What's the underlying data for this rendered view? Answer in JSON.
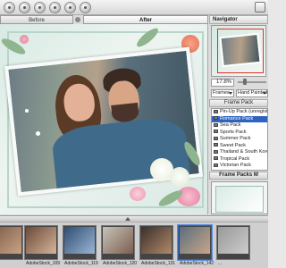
{
  "tabs": {
    "before": "Before",
    "after": "After"
  },
  "navigator": {
    "title": "Navigator",
    "zoom": "17.8%"
  },
  "frame_selector": {
    "type": "Frames",
    "style": "Hand Painted"
  },
  "frame_packs": {
    "title": "Frame Pack",
    "items": [
      {
        "label": "Pin-Up Pack (unregistered)",
        "selected": false
      },
      {
        "label": "Romance Pack",
        "selected": true
      },
      {
        "label": "Sea Pack",
        "selected": false
      },
      {
        "label": "Sports Pack",
        "selected": false
      },
      {
        "label": "Summer Pack",
        "selected": false
      },
      {
        "label": "Sweet Pack",
        "selected": false
      },
      {
        "label": "Thailand & South Korea",
        "selected": false
      },
      {
        "label": "Tropical Pack",
        "selected": false
      },
      {
        "label": "Victorian Pack",
        "selected": false
      }
    ]
  },
  "frame_pack_preview": {
    "title": "Frame Packs M"
  },
  "filmstrip": {
    "items": [
      {
        "label": "...",
        "colors": [
          "#7a5b48",
          "#c9a284"
        ]
      },
      {
        "label": "AdobeStock_109",
        "colors": [
          "#6a4a3a",
          "#d6b59a"
        ]
      },
      {
        "label": "AdobeStock_119",
        "colors": [
          "#2f4d72",
          "#9bb6d4"
        ]
      },
      {
        "label": "AdobeStock_120",
        "colors": [
          "#c8c2b8",
          "#7b5f50"
        ]
      },
      {
        "label": "AdobeStock_131",
        "colors": [
          "#3b2f2a",
          "#b08a6a"
        ]
      },
      {
        "label": "AdobeStock_142",
        "colors": [
          "#5a6f7c",
          "#c9a58a"
        ]
      },
      {
        "label": "...",
        "colors": [
          "#999999",
          "#cccccc"
        ]
      }
    ]
  },
  "colors": {
    "selection": "#2f63c0",
    "frame_accent": "#b9d4cb"
  }
}
